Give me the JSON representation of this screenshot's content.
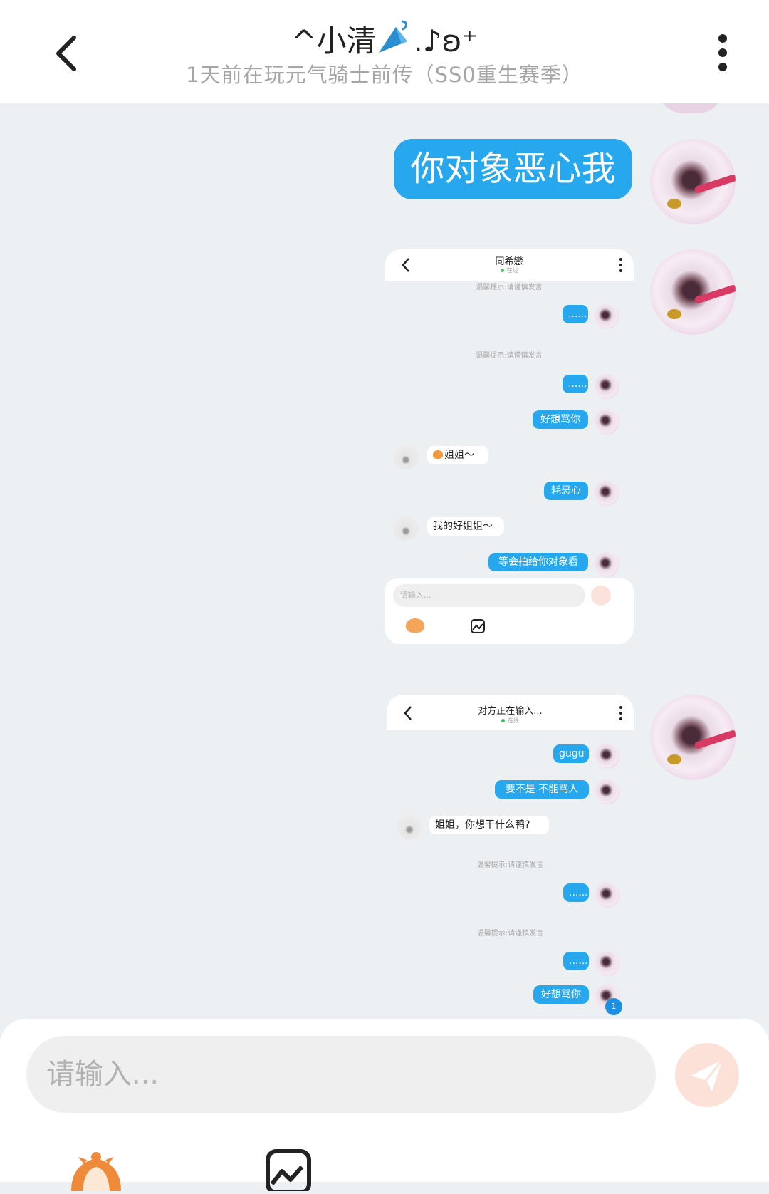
{
  "header": {
    "title_main": "^小清",
    "title_tail": ".♪ʚ⁺",
    "status": "1天前在玩元气骑士前传（SS0重生赛季）",
    "back_icon": "chevron-left-icon",
    "more_icon": "more-vertical-icon"
  },
  "messages": {
    "big_bubble": "你对象恶心我"
  },
  "shot1": {
    "title": "同希戀",
    "online": "在线",
    "tip1": "温馨提示:请谨慎发言",
    "dots1": "......",
    "tip2": "温馨提示:请谨慎发言",
    "dots2": "......",
    "msg_hao": "好想骂你",
    "msg_jiejie": "姐姐～",
    "msg_hao2": "耗恶心",
    "msg_wode": "我的好姐姐～",
    "msg_dengh": "等会拍给你对象看",
    "input_placeholder": "请输入..."
  },
  "shot2": {
    "title": "对方正在输入...",
    "online": "在线",
    "msg_gugu": "gugu",
    "msg_yaobu": "要不是 不能骂人",
    "msg_jiejie": "姐姐，你想干什么鸭?",
    "tip1": "温馨提示:请谨慎发言",
    "dots1": "......",
    "tip2": "温馨提示:请谨慎发言",
    "dots2": "......",
    "msg_hao": "好想骂你",
    "badge": "1"
  },
  "input_bar": {
    "placeholder": "请输入...",
    "send_icon": "send-icon",
    "emoji_icon": "emoji-face-icon",
    "image_icon": "image-icon"
  },
  "colors": {
    "accent": "#27a8ee",
    "background": "#ecf0f3",
    "send_button": "#fbe1d8"
  }
}
